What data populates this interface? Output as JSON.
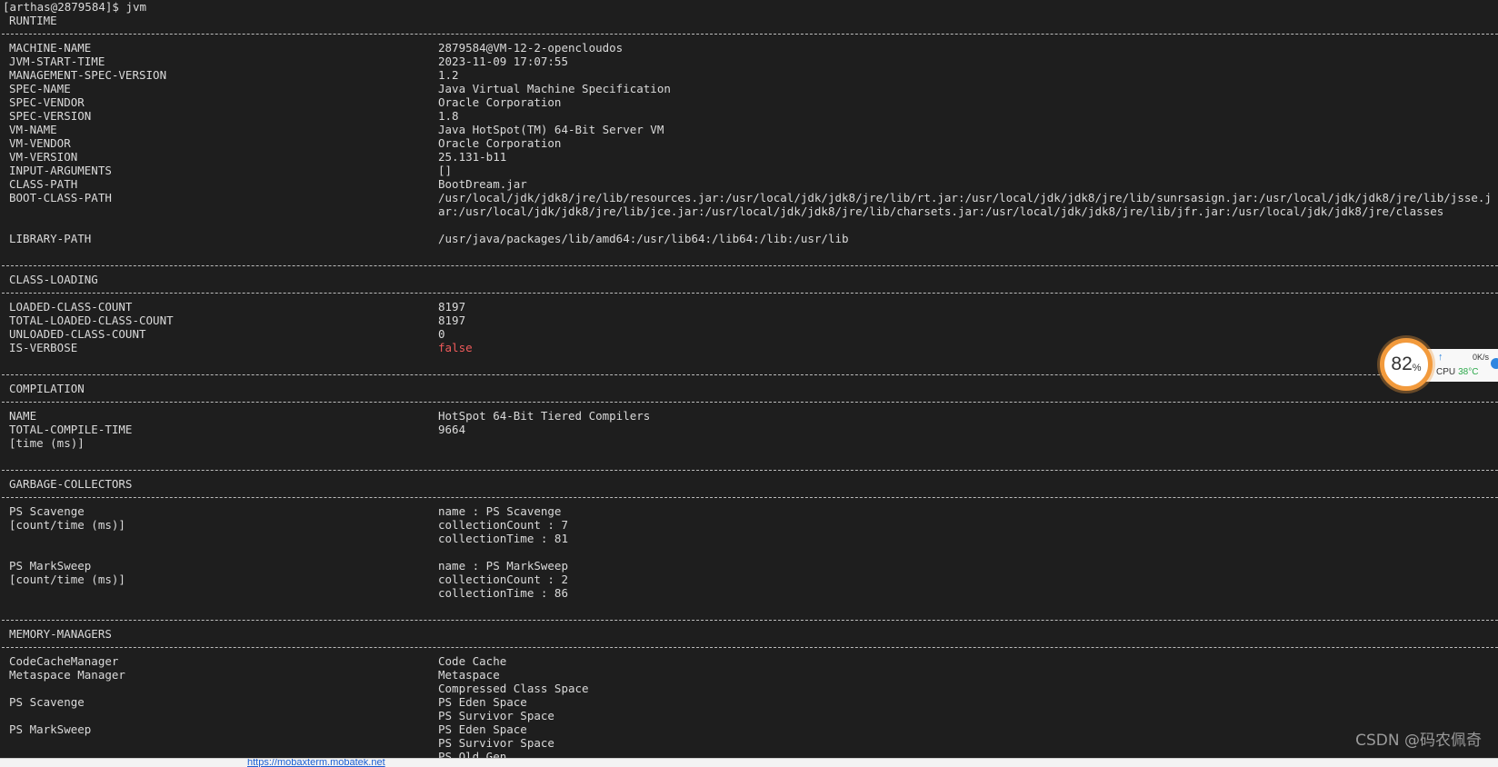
{
  "prompt": "[arthas@2879584]$ jvm",
  "runtime": {
    "title": "RUNTIME",
    "rows": [
      {
        "key": "MACHINE-NAME",
        "value": "2879584@VM-12-2-opencloudos"
      },
      {
        "key": "JVM-START-TIME",
        "value": "2023-11-09 17:07:55"
      },
      {
        "key": "MANAGEMENT-SPEC-VERSION",
        "value": "1.2"
      },
      {
        "key": "SPEC-NAME",
        "value": "Java Virtual Machine Specification"
      },
      {
        "key": "SPEC-VENDOR",
        "value": "Oracle Corporation"
      },
      {
        "key": "SPEC-VERSION",
        "value": "1.8"
      },
      {
        "key": "VM-NAME",
        "value": "Java HotSpot(TM) 64-Bit Server VM"
      },
      {
        "key": "VM-VENDOR",
        "value": "Oracle Corporation"
      },
      {
        "key": "VM-VERSION",
        "value": "25.131-b11"
      },
      {
        "key": "INPUT-ARGUMENTS",
        "value": "[]"
      },
      {
        "key": "CLASS-PATH",
        "value": "BootDream.jar"
      },
      {
        "key": "BOOT-CLASS-PATH",
        "value": "/usr/local/jdk/jdk8/jre/lib/resources.jar:/usr/local/jdk/jdk8/jre/lib/rt.jar:/usr/local/jdk/jdk8/jre/lib/sunrsasign.jar:/usr/local/jdk/jdk8/jre/lib/jsse.jar:/usr/local/jdk/jdk8/jre/lib/jce.jar:/usr/local/jdk/jdk8/jre/lib/charsets.jar:/usr/local/jdk/jdk8/jre/lib/jfr.jar:/usr/local/jdk/jdk8/jre/classes"
      },
      {
        "key": "LIBRARY-PATH",
        "value": "/usr/java/packages/lib/amd64:/usr/lib64:/lib64:/lib:/usr/lib"
      }
    ]
  },
  "class_loading": {
    "title": "CLASS-LOADING",
    "rows": [
      {
        "key": "LOADED-CLASS-COUNT",
        "value": "8197"
      },
      {
        "key": "TOTAL-LOADED-CLASS-COUNT",
        "value": "8197"
      },
      {
        "key": "UNLOADED-CLASS-COUNT",
        "value": "0"
      },
      {
        "key": "IS-VERBOSE",
        "value": "false"
      }
    ]
  },
  "compilation": {
    "title": "COMPILATION",
    "name_key": "NAME",
    "name_value": "HotSpot 64-Bit Tiered Compilers",
    "time_key": "TOTAL-COMPILE-TIME",
    "time_value": "9664",
    "time_unit": "[time (ms)]"
  },
  "garbage_collectors": {
    "title": "GARBAGE-COLLECTORS",
    "collectors": [
      {
        "name": "PS Scavenge",
        "unit": "[count/time (ms)]",
        "lines": [
          "name : PS Scavenge",
          "collectionCount : 7",
          "collectionTime : 81"
        ]
      },
      {
        "name": "PS MarkSweep",
        "unit": "[count/time (ms)]",
        "lines": [
          "name : PS MarkSweep",
          "collectionCount : 2",
          "collectionTime : 86"
        ]
      }
    ]
  },
  "memory_managers": {
    "title": "MEMORY-MANAGERS",
    "managers": [
      {
        "name": "CodeCacheManager",
        "pools": [
          "Code Cache"
        ]
      },
      {
        "name": "Metaspace Manager",
        "pools": [
          "Metaspace",
          "Compressed Class Space"
        ]
      },
      {
        "name": "PS Scavenge",
        "pools": [
          "PS Eden Space",
          "PS Survivor Space"
        ]
      },
      {
        "name": "PS MarkSweep",
        "pools": [
          "PS Eden Space",
          "PS Survivor Space",
          "PS Old Gen"
        ]
      }
    ]
  },
  "cpu_widget": {
    "percent": "82",
    "percent_unit": "%",
    "net_speed": "0K/s",
    "cpu_label": "CPU",
    "cpu_temp": "38°C",
    "up_icon": "arrow-up-icon",
    "accent_color": "#f29a3c"
  },
  "watermark": "CSDN @码农佩奇",
  "status_bar": {
    "link_text": "https://mobaxterm.mobatek.net"
  },
  "colors": {
    "background": "#1e1e1e",
    "text": "#dadada",
    "false_value": "#ee5a5a"
  }
}
